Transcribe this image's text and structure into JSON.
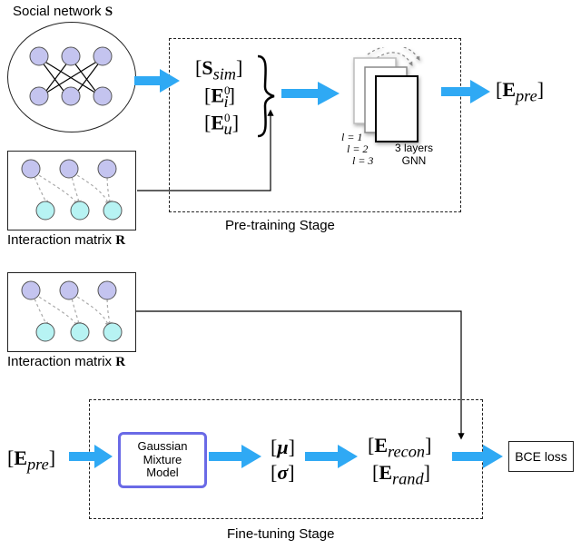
{
  "top": {
    "social_network_title": "Social network",
    "social_network_sym": "S",
    "interaction_matrix_title": "Interaction matrix",
    "interaction_matrix_sym": "R",
    "ssim": "S",
    "ssim_sub": "sim",
    "Ei0": "E",
    "Eu0": "E",
    "Ei0_sub": "i",
    "Eu0_sub": "u",
    "l1": "l = 1",
    "l2": "l = 2",
    "l3": "l = 3",
    "gnn_caption_line1": "3 layers",
    "gnn_caption_line2": "GNN",
    "Epre": "E",
    "Epre_sub": "pre",
    "stage_label": "Pre-training Stage"
  },
  "bottom": {
    "interaction_matrix_title": "Interaction matrix",
    "interaction_matrix_sym": "R",
    "Epre": "E",
    "Epre_sub": "pre",
    "gmm_line1": "Gaussian",
    "gmm_line2": "Mixture",
    "gmm_line3": "Model",
    "mu": "μ",
    "sigma": "σ",
    "Erecon": "E",
    "Erecon_sub": "recon",
    "Erand": "E",
    "Erand_sub": "rand",
    "bce": "BCE loss",
    "stage_label": "Fine-tuning Stage"
  }
}
